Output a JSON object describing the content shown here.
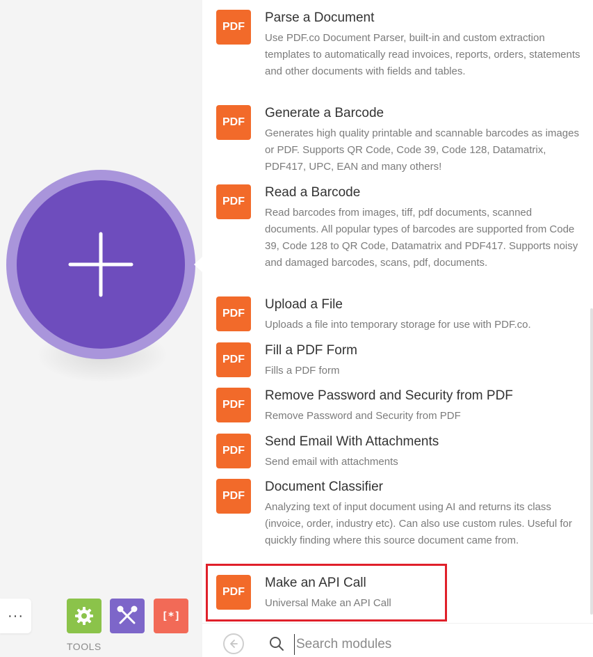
{
  "canvas": {
    "more_label": "···",
    "tools_label": "TOOLS",
    "brackets_label": "[*]"
  },
  "modules": [
    {
      "badge": "PDF",
      "title": "Parse a Document",
      "description": "Use PDF.co Document Parser, built-in and custom extraction templates to automatically read invoices, reports, orders, statements and other documents with fields and tables."
    },
    {
      "badge": "PDF",
      "title": "Generate a Barcode",
      "description": "Generates high quality printable and scannable barcodes as images or PDF. Supports QR Code, Code 39, Code 128, Datamatrix, PDF417, UPC, EAN and many others!"
    },
    {
      "badge": "PDF",
      "title": "Read a Barcode",
      "description": "Read barcodes from images, tiff, pdf documents, scanned documents. All popular types of barcodes are supported from Code 39, Code 128 to QR Code, Datamatrix and PDF417. Supports noisy and damaged barcodes, scans, pdf, documents."
    },
    {
      "badge": "PDF",
      "title": "Upload a File",
      "description": "Uploads a file into temporary storage for use with PDF.co."
    },
    {
      "badge": "PDF",
      "title": "Fill a PDF Form",
      "description": "Fills a PDF form"
    },
    {
      "badge": "PDF",
      "title": "Remove Password and Security from PDF",
      "description": "Remove Password and Security from PDF"
    },
    {
      "badge": "PDF",
      "title": "Send Email With Attachments",
      "description": "Send email with attachments"
    },
    {
      "badge": "PDF",
      "title": "Document Classifier",
      "description": "Analyzing text of input document using AI and returns its class (invoice, order, industry etc). Can also use custom rules. Useful for quickly finding where this source document came from."
    },
    {
      "badge": "PDF",
      "title": "Make an API Call",
      "description": "Universal Make an API Call"
    }
  ],
  "search": {
    "placeholder": "Search modules"
  },
  "colors": {
    "accent_purple": "#6e4dbd",
    "pdf_orange": "#f26a2a",
    "highlight_red": "#e0202a"
  }
}
